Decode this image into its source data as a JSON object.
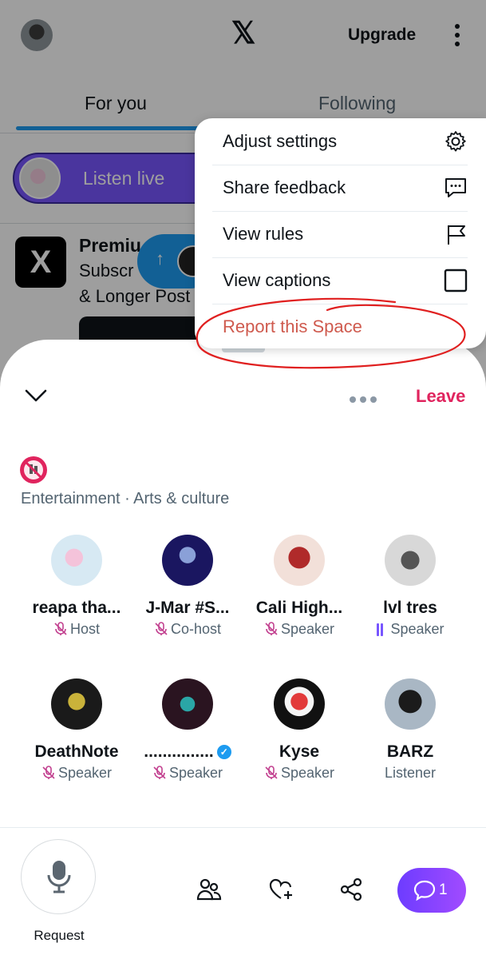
{
  "header": {
    "upgrade_label": "Upgrade"
  },
  "tabs": [
    {
      "label": "For you",
      "active": true
    },
    {
      "label": "Following",
      "active": false
    }
  ],
  "listen_live": {
    "label": "Listen live"
  },
  "premium_card": {
    "title": "Premiu",
    "line1": "Subscr",
    "line2": "& Longer Post"
  },
  "menu": {
    "items": [
      {
        "label": "Adjust settings",
        "icon": "gear-icon"
      },
      {
        "label": "Share feedback",
        "icon": "feedback-icon"
      },
      {
        "label": "View rules",
        "icon": "flag-icon"
      },
      {
        "label": "View captions",
        "icon": "checkbox-icon",
        "checked": false
      },
      {
        "label": "Report this Space",
        "icon": "",
        "highlighted": true
      }
    ],
    "highlight_color": "#d93b3b"
  },
  "space": {
    "leave_label": "Leave",
    "category": "Entertainment · Arts & culture",
    "participants": [
      {
        "name": "reapa tha...",
        "role": "Host",
        "mic": "muted"
      },
      {
        "name": "J-Mar #S...",
        "role": "Co-host",
        "mic": "muted"
      },
      {
        "name": "Cali High...",
        "role": "Speaker",
        "mic": "muted"
      },
      {
        "name": "lvl tres",
        "role": "Speaker",
        "mic": "speaking"
      },
      {
        "name": "DeathNote",
        "role": "Speaker",
        "mic": "muted"
      },
      {
        "name": "...............",
        "role": "Speaker",
        "mic": "muted",
        "verified": true
      },
      {
        "name": "Kyse",
        "role": "Speaker",
        "mic": "muted"
      },
      {
        "name": "BARZ",
        "role": "Listener",
        "mic": "none"
      }
    ]
  },
  "bottom_bar": {
    "request_label": "Request",
    "chat_count": "1",
    "accent": "#7856ff"
  },
  "colors": {
    "leave": "#e0245e",
    "link_blue": "#1d9bf0",
    "muted_mic": "#c2408f"
  }
}
